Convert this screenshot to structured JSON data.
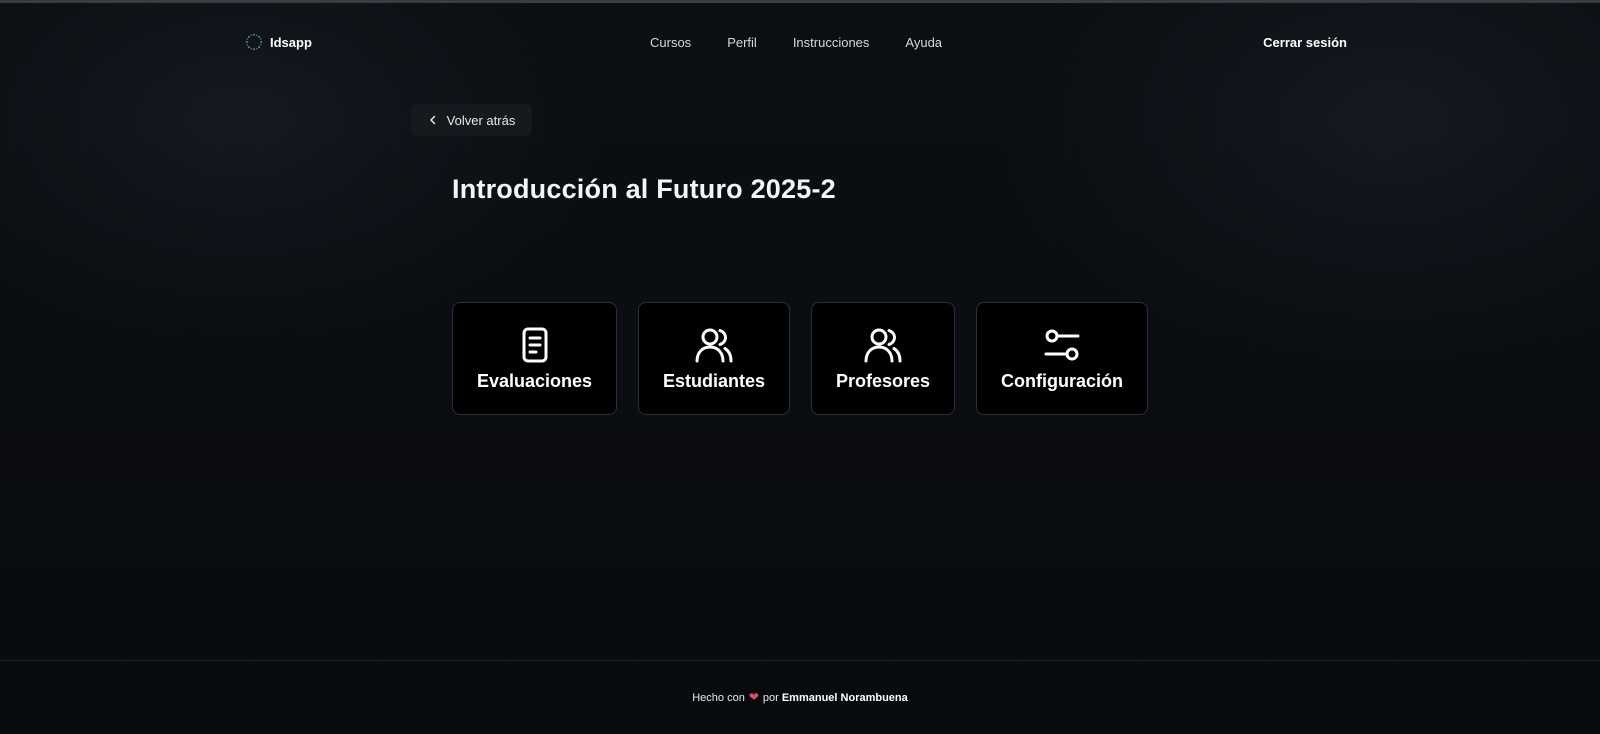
{
  "brand": {
    "name": "Idsapp",
    "icon": "dotted-circle-logo-icon"
  },
  "nav": {
    "items": [
      {
        "label": "Cursos"
      },
      {
        "label": "Perfil"
      },
      {
        "label": "Instrucciones"
      },
      {
        "label": "Ayuda"
      }
    ],
    "logout_label": "Cerrar sesión"
  },
  "back": {
    "label": "Volver atrás",
    "icon": "chevron-left-icon"
  },
  "page": {
    "title": "Introducción al Futuro 2025-2"
  },
  "cards": [
    {
      "label": "Evaluaciones",
      "icon": "document-icon"
    },
    {
      "label": "Estudiantes",
      "icon": "users-icon"
    },
    {
      "label": "Profesores",
      "icon": "users-icon"
    },
    {
      "label": "Configuración",
      "icon": "sliders-icon"
    }
  ],
  "footer": {
    "prefix": "Hecho con",
    "heart": "❤",
    "by": "por",
    "author": "Emmanuel Norambuena"
  },
  "colors": {
    "background": "#0a0d11",
    "card_bg": "#000000",
    "card_border": "#2c2f34",
    "heart": "#e4476a"
  }
}
